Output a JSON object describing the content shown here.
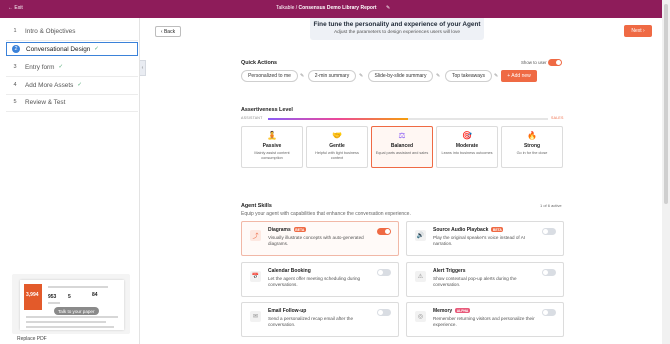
{
  "topbar": {
    "exit": "← Exit",
    "prefix": "Talkable /",
    "title": "Consensus Demo Library Report",
    "edit_icon": "✎"
  },
  "sidebar": {
    "steps": [
      {
        "num": "1",
        "label": "Intro & Objectives",
        "check": ""
      },
      {
        "num": "2",
        "label": "Conversational Design",
        "check": "✓"
      },
      {
        "num": "3",
        "label": "Entry form",
        "check": "✓"
      },
      {
        "num": "4",
        "label": "Add More Assets",
        "check": "✓"
      },
      {
        "num": "5",
        "label": "Review & Test",
        "check": ""
      }
    ],
    "preview": {
      "stat_main": "3,994",
      "stats": [
        "953",
        "5",
        "84"
      ],
      "talk_label": "Talk to your paper"
    },
    "replace_label": "Replace PDF",
    "collapse_icon": "‹"
  },
  "header": {
    "back_label": "‹  Back",
    "next_label": "Next  ›",
    "hero_title": "Fine tune the personality and experience of your Agent",
    "hero_subtitle": "Adjust the parameters to design experiences users will love"
  },
  "quick_actions": {
    "title": "Quick Actions",
    "show_to_user": "Show to user",
    "show_to_user_on": true,
    "chips": [
      "Personalized to me",
      "2-min summary",
      "Slide-by-slide summary",
      "Top takeaways"
    ],
    "pencil": "✎",
    "add_label": "+ Add new"
  },
  "assertiveness": {
    "title": "Assertiveness Level",
    "left_label": "ASSISTANT",
    "right_label": "SALES",
    "level_fraction": 0.5,
    "levels": [
      {
        "icon": "🧘",
        "name": "Passive",
        "desc": "Mainly assist content consumption"
      },
      {
        "icon": "🤝",
        "name": "Gentle",
        "desc": "Helpful with light business context"
      },
      {
        "icon": "⚖",
        "name": "Balanced",
        "desc": "Equal parts assistant and sales"
      },
      {
        "icon": "🎯",
        "name": "Moderate",
        "desc": "Leans into business outcomes"
      },
      {
        "icon": "🔥",
        "name": "Strong",
        "desc": "Go in for the close"
      }
    ],
    "selected": "Balanced"
  },
  "skills": {
    "title": "Agent Skills",
    "subtitle": "Equip your agent with capabilities that enhance the conversation experience.",
    "count": "1 of 6 active",
    "items": [
      {
        "icon": "⤴",
        "name": "Diagrams",
        "badge": "BETA",
        "desc": "Visually illustrate concepts with auto-generated diagrams.",
        "on": true
      },
      {
        "icon": "🔊",
        "name": "Source Audio Playback",
        "badge": "BETA",
        "desc": "Play the original speaker's voice instead of AI narration.",
        "on": false
      },
      {
        "icon": "📅",
        "name": "Calendar Booking",
        "badge": "",
        "desc": "Let the agent offer meeting scheduling during conversations.",
        "on": false
      },
      {
        "icon": "⚠",
        "name": "Alert Triggers",
        "badge": "",
        "desc": "Show contextual pop-up alerts during the conversation.",
        "on": false
      },
      {
        "icon": "✉",
        "name": "Email Follow-up",
        "badge": "",
        "desc": "Send a personalized recap email after the conversation.",
        "on": false
      },
      {
        "icon": "◎",
        "name": "Memory",
        "badge": "ALPHA",
        "desc": "Remember returning visitors and personalize their experience.",
        "on": false
      }
    ]
  }
}
